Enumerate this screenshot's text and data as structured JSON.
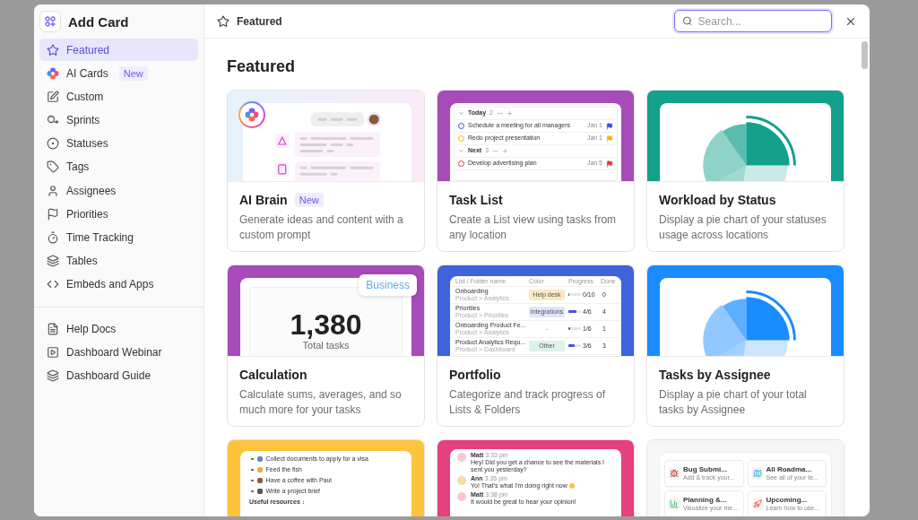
{
  "dialog": {
    "title": "Add Card"
  },
  "sidebar": {
    "items": [
      {
        "label": "Featured",
        "selected": true
      },
      {
        "label": "AI Cards",
        "badge": "New",
        "selected": false
      },
      {
        "label": "Custom",
        "selected": false
      },
      {
        "label": "Sprints",
        "selected": false
      },
      {
        "label": "Statuses",
        "selected": false
      },
      {
        "label": "Tags",
        "selected": false
      },
      {
        "label": "Assignees",
        "selected": false
      },
      {
        "label": "Priorities",
        "selected": false
      },
      {
        "label": "Time Tracking",
        "selected": false
      },
      {
        "label": "Tables",
        "selected": false
      },
      {
        "label": "Embeds and Apps",
        "selected": false
      }
    ],
    "links": [
      {
        "label": "Help Docs"
      },
      {
        "label": "Dashboard Webinar"
      },
      {
        "label": "Dashboard Guide"
      }
    ]
  },
  "header": {
    "title": "Featured",
    "search": {
      "placeholder": "Search..."
    }
  },
  "section": {
    "title": "Featured"
  },
  "cards": [
    {
      "title": "AI Brain",
      "badge": "New",
      "description": "Generate ideas and content with a custom prompt",
      "preview": {
        "kind": "ai"
      }
    },
    {
      "title": "Task List",
      "description": "Create a List view using tasks from any location",
      "color": "#a64bb9",
      "preview": {
        "kind": "list",
        "groups": [
          {
            "label": "Today",
            "count": "2",
            "tasks": [
              {
                "name": "Schedule a meeting for all managers",
                "date": "Jan 1",
                "color": "#3553e0"
              },
              {
                "name": "Redo project presentation",
                "date": "Jan 1",
                "color": "#f7b500"
              }
            ]
          },
          {
            "label": "Next",
            "count": "3",
            "tasks": [
              {
                "name": "Develop advertising plan",
                "date": "Jan 5",
                "color": "#e53935"
              }
            ]
          }
        ]
      }
    },
    {
      "title": "Workload by Status",
      "description": "Display a pie chart of your statuses usage across locations",
      "color": "#13a08c",
      "preview": {
        "kind": "pie"
      }
    },
    {
      "title": "Calculation",
      "description": "Calculate sums, averages, and so much more for your tasks",
      "color": "#a64bb9",
      "preview": {
        "kind": "calc",
        "badge": "Business",
        "value": "1,380",
        "caption": "Total tasks"
      }
    },
    {
      "title": "Portfolio",
      "description": "Categorize and track progress of Lists & Folders",
      "color": "#3e63dd",
      "preview": {
        "kind": "table",
        "columns": [
          "List / Folder name",
          "Color",
          "Progress",
          "Done"
        ],
        "rows": [
          {
            "name": "Onboarding",
            "path": "Product > Analytics",
            "tag": "Help desk",
            "color": "#fbe9c2",
            "level": 0,
            "progress": "0/10",
            "done": "0"
          },
          {
            "name": "Priorities",
            "path": "Product > Priorities",
            "tag": "Integrations",
            "color": "#dfe4fb",
            "level": 0.67,
            "progress": "4/6",
            "done": "4"
          },
          {
            "name": "Onboarding Product Fe...",
            "path": "Product > Analytics",
            "tag": "-",
            "level": 0.17,
            "progress": "1/6",
            "done": "1"
          },
          {
            "name": "Product Analytics Requ...",
            "path": "Product > Dashboard",
            "tag": "Other",
            "color": "#dcf2ec",
            "level": 0.5,
            "progress": "3/6",
            "done": "3"
          }
        ]
      }
    },
    {
      "title": "Tasks by Assignee",
      "description": "Display a pie chart of your total tasks by Assignee",
      "color": "#1a8cff",
      "preview": {
        "kind": "pie"
      }
    },
    {
      "color": "#fcc33d",
      "preview": {
        "kind": "todo",
        "items": [
          "Collect documents to apply for a visa",
          "Feed the fish",
          "Have a coffee with Paul",
          "Write a project brief"
        ],
        "footer": "Useful resources ↓"
      }
    },
    {
      "color": "#e5407f",
      "preview": {
        "kind": "chat",
        "messages": [
          {
            "author": "Matt",
            "time": "3:33 pm",
            "text": "Hey! Did you get a chance to see the materials I sent you yesterday?"
          },
          {
            "author": "Ann",
            "time": "3:35 pm",
            "text": "Yo! That's what I'm doing right now"
          },
          {
            "author": "Matt",
            "time": "3:38 pm",
            "text": "It would be great to hear your opinion!"
          }
        ]
      }
    },
    {
      "color": "#f6f6f6",
      "preview": {
        "kind": "templates",
        "tiles": [
          {
            "title": "Bug Submi...",
            "subtitle": "Add & track your..."
          },
          {
            "title": "All Roadma...",
            "subtitle": "See all of your te..."
          },
          {
            "title": "Planning &...",
            "subtitle": "Visualize your me..."
          },
          {
            "title": "Upcoming...",
            "subtitle": "Learn how to use..."
          }
        ]
      }
    }
  ]
}
